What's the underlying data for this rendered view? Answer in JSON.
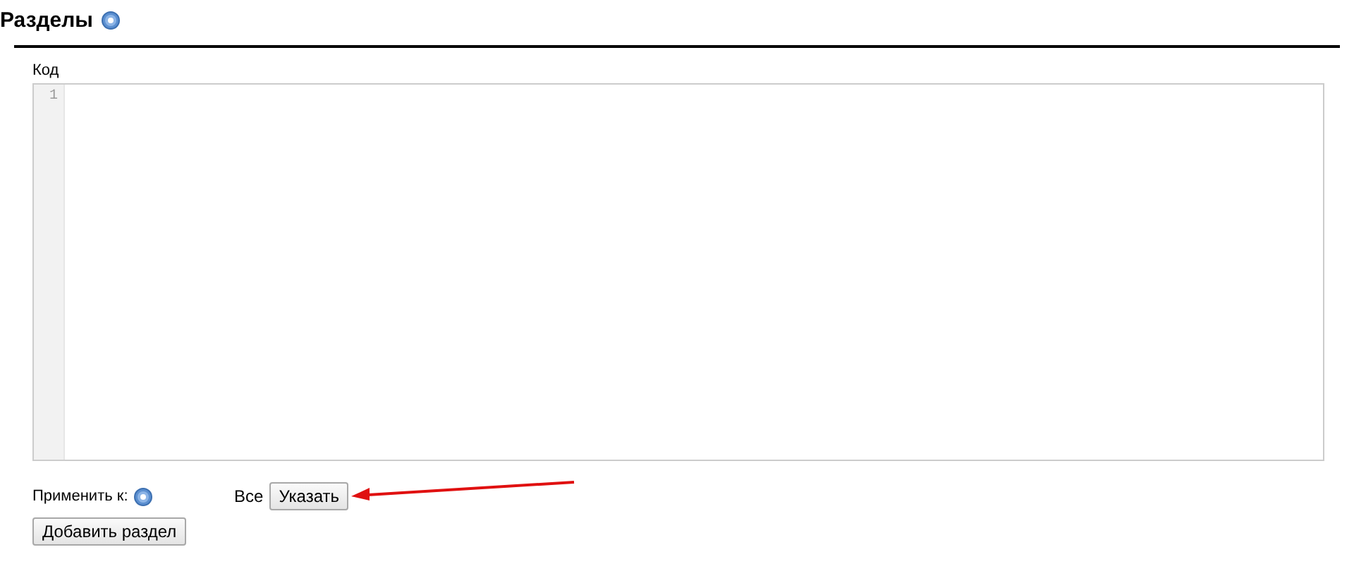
{
  "title": "Разделы",
  "code_editor": {
    "label": "Код",
    "line_numbers": [
      "1"
    ]
  },
  "apply_to": {
    "label": "Применить к:",
    "value": "Все",
    "button": "Указать"
  },
  "add_button": "Добавить раздел"
}
